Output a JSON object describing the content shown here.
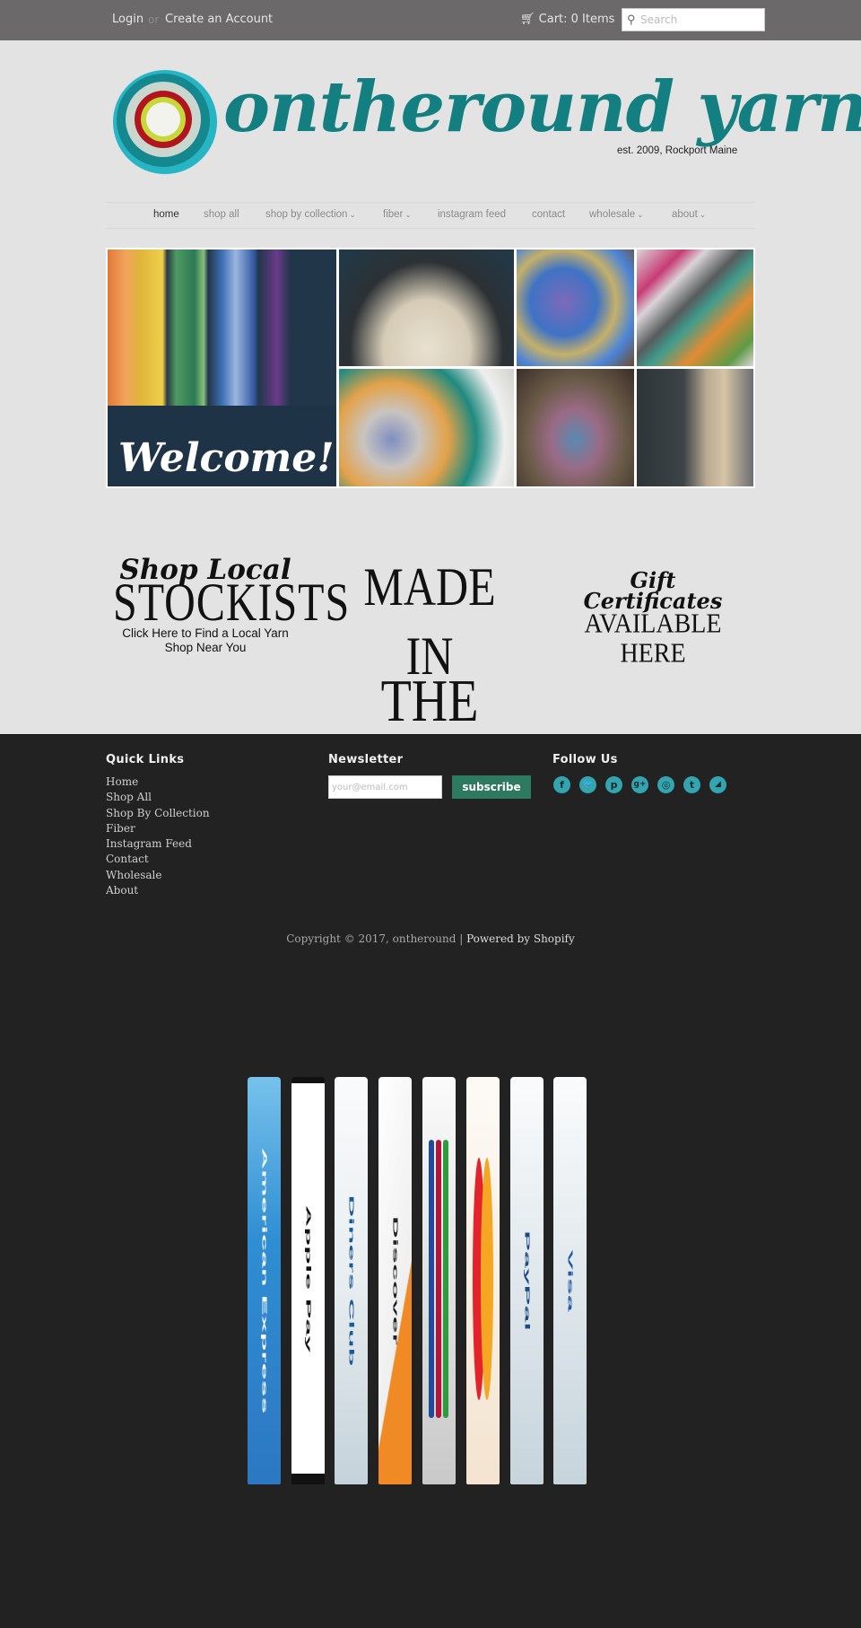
{
  "topbar": {
    "login": "Login",
    "or": "or",
    "create_account": "Create an Account",
    "cart_icon": "shopping-cart-icon",
    "cart": "Cart: 0 Items",
    "search_icon": "search-icon",
    "search_placeholder": "Search"
  },
  "logo": {
    "name": "ontheround yarn",
    "tagline": "est. 2009, Rockport Maine"
  },
  "nav": {
    "items": [
      {
        "label": "home",
        "active": true,
        "dropdown": false
      },
      {
        "label": "shop all",
        "dropdown": false
      },
      {
        "label": "shop by collection",
        "dropdown": true
      },
      {
        "label": "fiber",
        "dropdown": true
      },
      {
        "label": "instagram feed",
        "dropdown": false
      },
      {
        "label": "contact",
        "dropdown": false
      },
      {
        "label": "wholesale",
        "dropdown": true
      },
      {
        "label": "about",
        "dropdown": true
      }
    ],
    "chevron": "⌄"
  },
  "hero": {
    "welcome": "Welcome!",
    "tiles": [
      "hand-dyed yarn skeins",
      "woman holding undyed yarn",
      "colorful roving",
      "knitted swatches",
      "yarn balls in bowl",
      "yarn basket",
      "woman spinning yarn"
    ]
  },
  "promos": {
    "stockists": {
      "script": "Shop Local",
      "title": "Stockists",
      "caption_line1": "Click Here to Find a Local Yarn",
      "caption_line2": "Shop Near You"
    },
    "usa": {
      "line1": "Made In",
      "line2": "The USA"
    },
    "gift": {
      "script1": "Gift",
      "script2": "Certificates",
      "title": "Available Here"
    }
  },
  "footer": {
    "quick_links_title": "Quick Links",
    "quick_links": [
      "Home",
      "Shop All",
      "Shop By Collection",
      "Fiber",
      "Instagram Feed",
      "Contact",
      "Wholesale",
      "About"
    ],
    "newsletter_title": "Newsletter",
    "email_placeholder": "your@email.com",
    "subscribe_label": "subscribe",
    "follow_title": "Follow Us",
    "social": [
      {
        "name": "facebook",
        "glyph": "f"
      },
      {
        "name": "twitter",
        "glyph": "🐦"
      },
      {
        "name": "pinterest",
        "glyph": "p"
      },
      {
        "name": "google-plus",
        "glyph": "g+"
      },
      {
        "name": "instagram",
        "glyph": "◎"
      },
      {
        "name": "tumblr",
        "glyph": "t"
      },
      {
        "name": "rss",
        "glyph": "◢"
      }
    ],
    "copyright": "Copyright © 2017, ontheround | ",
    "powered": "Powered by Shopify"
  },
  "payments": [
    "American Express",
    "Apple Pay",
    "Diners Club",
    "Discover",
    "JCB",
    "MasterCard",
    "PayPal",
    "Visa"
  ],
  "colors": {
    "brand_teal": "#137f80",
    "social_teal": "#33a5b1",
    "subscribe_green": "#2d7a60",
    "topbar": "#6b6969",
    "page_bg": "#e3e3e3",
    "footer_bg": "#222222"
  }
}
